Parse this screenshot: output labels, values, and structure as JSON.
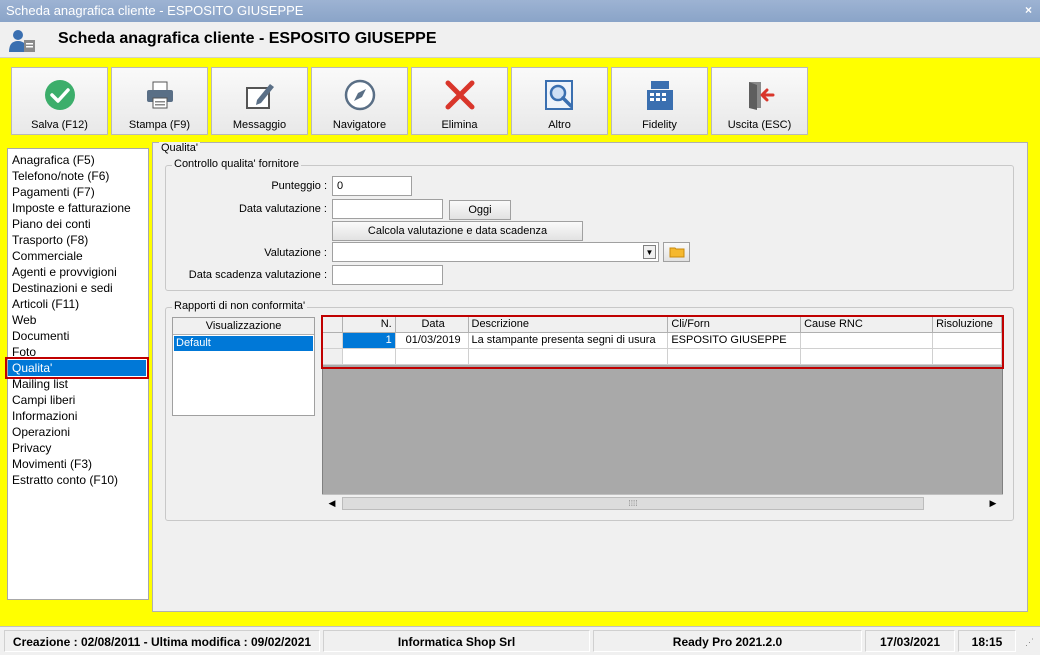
{
  "window": {
    "title": "Scheda anagrafica cliente - ESPOSITO GIUSEPPE",
    "close_glyph": "×"
  },
  "header": {
    "title": "Scheda anagrafica cliente - ESPOSITO GIUSEPPE",
    "icon": "customer-card-icon"
  },
  "toolbar": [
    {
      "label": "Salva (F12)",
      "icon": "check-circle-icon"
    },
    {
      "label": "Stampa (F9)",
      "icon": "printer-icon"
    },
    {
      "label": "Messaggio",
      "icon": "compose-message-icon"
    },
    {
      "label": "Navigatore",
      "icon": "compass-icon"
    },
    {
      "label": "Elimina",
      "icon": "red-x-icon"
    },
    {
      "label": "Altro",
      "icon": "search-document-icon"
    },
    {
      "label": "Fidelity",
      "icon": "cash-register-icon"
    },
    {
      "label": "Uscita (ESC)",
      "icon": "exit-door-icon"
    }
  ],
  "sidebar": {
    "items": [
      "Anagrafica (F5)",
      "Telefono/note (F6)",
      "Pagamenti (F7)",
      "Imposte e fatturazione",
      "Piano dei conti",
      "Trasporto (F8)",
      "Commerciale",
      "Agenti e provvigioni",
      "Destinazioni e sedi",
      "Articoli (F11)",
      "Web",
      "Documenti",
      "Foto",
      "Qualita'",
      "Mailing list",
      "Campi liberi",
      "Informazioni",
      "Operazioni",
      "Privacy",
      "Movimenti (F3)",
      "Estratto conto (F10)"
    ],
    "selected": "Qualita'"
  },
  "qualita": {
    "section_title": "Qualita'",
    "controllo": {
      "legend": "Controllo qualita' fornitore",
      "punteggio_label": "Punteggio :",
      "punteggio_value": "0",
      "data_valutazione_label": "Data valutazione :",
      "data_valutazione_value": "",
      "oggi_button": "Oggi",
      "calcola_button": "Calcola valutazione e data scadenza",
      "valutazione_label": "Valutazione :",
      "valutazione_value": "",
      "data_scadenza_label": "Data scadenza valutazione :",
      "data_scadenza_value": ""
    },
    "rapporti": {
      "legend": "Rapporti di non conformita'",
      "visualizzazione_header": "Visualizzazione",
      "visualizzazione_items": [
        "Default"
      ],
      "columns": [
        "N.",
        "Data",
        "Descrizione",
        "Cli/Forn",
        "Cause RNC",
        "Risoluzione"
      ],
      "rows": [
        {
          "n": "1",
          "data": "01/03/2019",
          "descrizione": "La stampante presenta segni di usura",
          "cli_forn": "ESPOSITO GIUSEPPE",
          "cause": "",
          "risoluzione": ""
        }
      ]
    }
  },
  "status": {
    "creation": "Creazione : 02/08/2011 - Ultima modifica : 09/02/2021",
    "company": "Informatica Shop Srl",
    "product": "Ready Pro 2021.2.0",
    "date": "17/03/2021",
    "time": "18:15"
  },
  "colors": {
    "accent_yellow": "#ffff00",
    "selection_blue": "#0078d7",
    "highlight_red": "#c00000"
  }
}
